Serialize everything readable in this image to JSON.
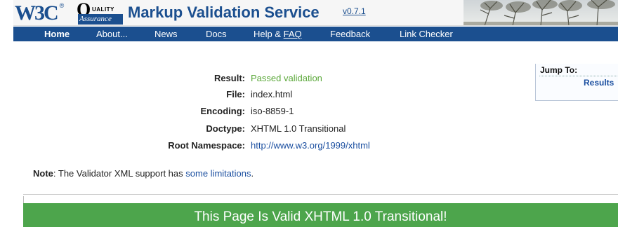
{
  "banner": {
    "w3c_logo": "W3C",
    "w3c_reg": "®",
    "qa_q": "Q",
    "qa_uality": "UALITY",
    "qa_assurance": "Assurance",
    "title": "Markup Validation Service",
    "version": "v0.7.1"
  },
  "nav": {
    "items": [
      {
        "label": "Home"
      },
      {
        "label": "About..."
      },
      {
        "label": "News"
      },
      {
        "label": "Docs"
      },
      {
        "label_prefix": "Help & ",
        "label_underlined": "FAQ"
      },
      {
        "label": "Feedback"
      },
      {
        "label": "Link Checker"
      }
    ]
  },
  "result": {
    "rows": [
      {
        "label": "Result:",
        "value": "Passed validation"
      },
      {
        "label": "File:",
        "value": "index.html"
      },
      {
        "label": "Encoding:",
        "value": "iso-8859-1"
      },
      {
        "label": "Doctype:",
        "value": "XHTML 1.0 Transitional"
      },
      {
        "label": "Root Namespace:",
        "value": "http://www.w3.org/1999/xhtml"
      }
    ]
  },
  "jump": {
    "title": "Jump To:",
    "link": "Results"
  },
  "note": {
    "bold": "Note",
    "text": ": The Validator XML support has ",
    "link": "some limitations",
    "end": "."
  },
  "valid_banner": {
    "text": "This Page Is Valid XHTML 1.0 Transitional!"
  },
  "colors": {
    "brand_blue": "#1b4f8f",
    "pass_green": "#5ba83a",
    "banner_green": "#4da54c",
    "link_blue": "#1b4fa0"
  }
}
